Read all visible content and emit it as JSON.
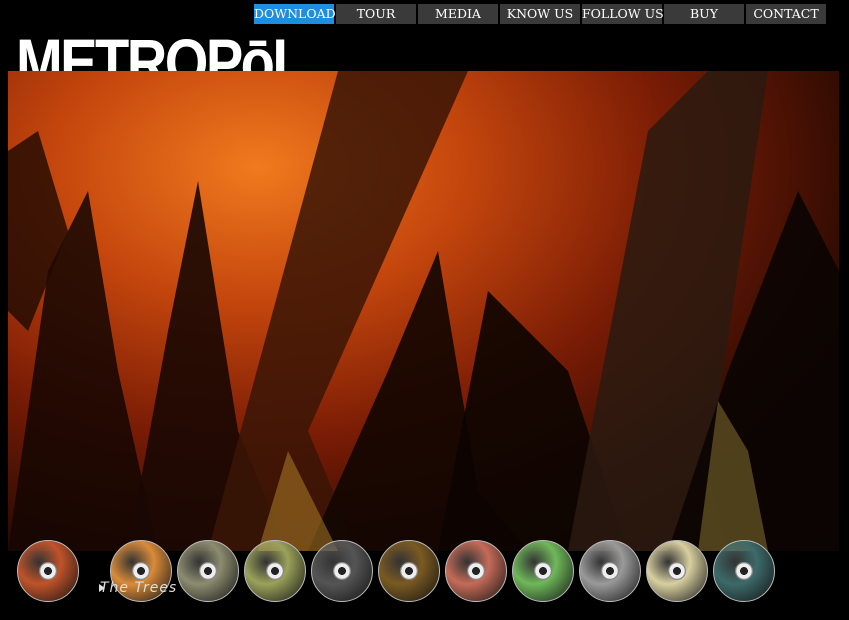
{
  "brand": {
    "logo_text": "METROPōL"
  },
  "nav": [
    {
      "label": "DOWNLOAD",
      "active": true
    },
    {
      "label": "TOUR"
    },
    {
      "label": "MEDIA"
    },
    {
      "label": "KNOW US"
    },
    {
      "label": "FOLLOW US"
    },
    {
      "label": "BUY"
    },
    {
      "label": "CONTACT"
    }
  ],
  "player": {
    "now_playing": "The Trees"
  },
  "discs": [
    {
      "name": "disc-1",
      "color": "#c0532a"
    },
    {
      "name": "disc-2",
      "color": "#d98b3a"
    },
    {
      "name": "disc-3",
      "color": "#8c8c70"
    },
    {
      "name": "disc-4",
      "color": "#9aa25a"
    },
    {
      "name": "disc-5",
      "color": "#555555"
    },
    {
      "name": "disc-6",
      "color": "#7a5a22"
    },
    {
      "name": "disc-7",
      "color": "#c46b58"
    },
    {
      "name": "disc-8",
      "color": "#6fb85a"
    },
    {
      "name": "disc-9",
      "color": "#9a9a9a"
    },
    {
      "name": "disc-10",
      "color": "#d8cfa0"
    },
    {
      "name": "disc-11",
      "color": "#3d6a6a"
    }
  ]
}
